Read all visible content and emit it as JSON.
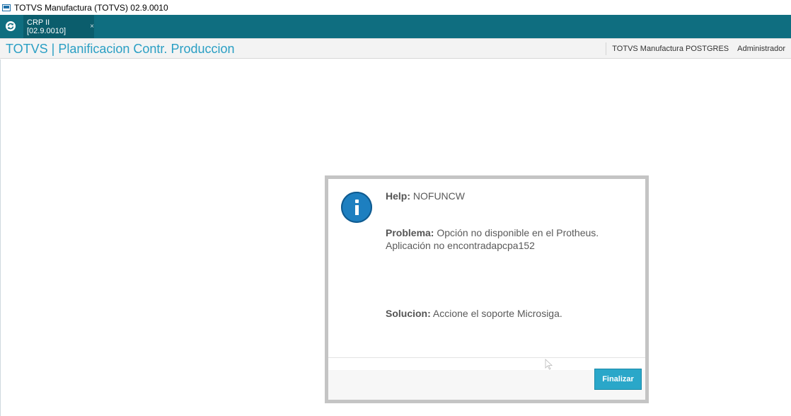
{
  "window": {
    "title": "TOTVS Manufactura (TOTVS) 02.9.0010"
  },
  "tabbar": {
    "home_icon": "refresh-circle-icon",
    "tabs": [
      {
        "label": "CRP II [02.9.0010]",
        "close": "×"
      }
    ]
  },
  "header": {
    "title": "TOTVS | Planificacion Contr. Produccion",
    "company": "TOTVS Manufactura POSTGRES",
    "user": "Administrador"
  },
  "dialog": {
    "icon": "info-icon",
    "help_label": "Help:",
    "help_value": "NOFUNCW",
    "problem_label": "Problema:",
    "problem_value": "Opción no disponible en el Protheus. Aplicación no encontradapcpa152",
    "solution_label": "Solucion:",
    "solution_value": "Accione el soporte Microsiga.",
    "finalizar_label": "Finalizar"
  },
  "colors": {
    "tabbar_bg": "#0f6e80",
    "title_accent": "#2a9fc4",
    "button_bg": "#2aa7c9",
    "info_icon": "#1d7fc0"
  }
}
